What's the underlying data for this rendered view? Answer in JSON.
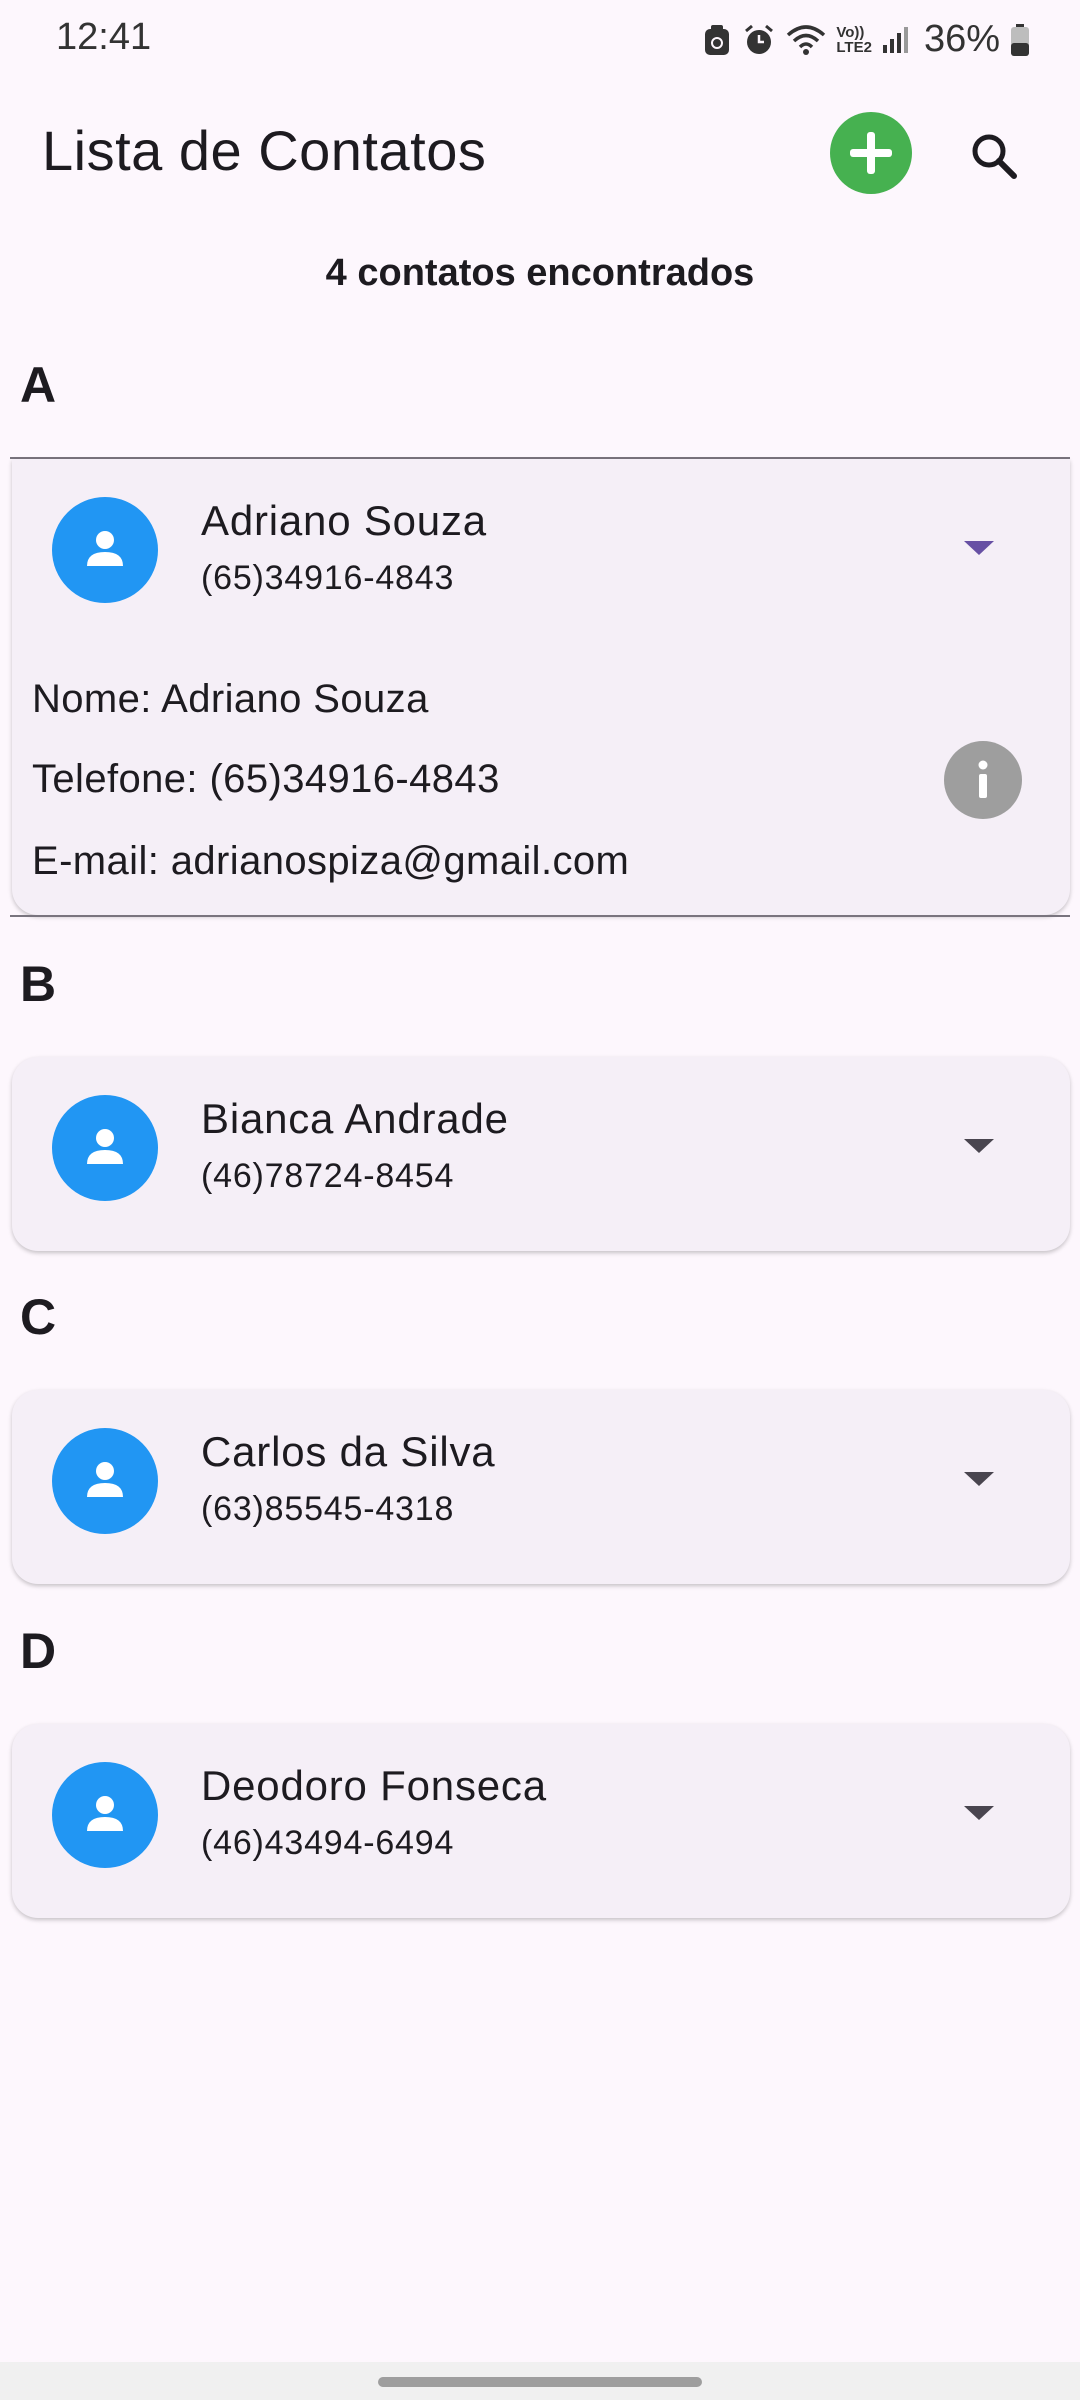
{
  "status_bar": {
    "time": "12:41",
    "battery_percent": "36%",
    "icons": [
      "cast-icon",
      "alarm-icon",
      "wifi-icon",
      "volte-icon",
      "signal-icon",
      "battery-icon"
    ],
    "volte_label_top": "Vo))",
    "volte_label_bottom": "LTE2"
  },
  "app_bar": {
    "title": "Lista de Contatos",
    "add_icon": "add-circle-icon",
    "search_icon": "search-icon"
  },
  "summary": "4 contatos encontrados",
  "colors": {
    "background": "#fdf7fd",
    "card": "#f5eff7",
    "avatar": "#2196f3",
    "add_button": "#46b150",
    "info_button": "#9e9e9e",
    "accent": "#6750a4"
  },
  "sections": [
    {
      "letter": "A",
      "contacts": [
        {
          "name": "Adriano Souza",
          "phone": "(65)34916-4843",
          "expanded": true,
          "details": {
            "name_line": "Nome: Adriano Souza",
            "phone_line": "Telefone: (65)34916-4843",
            "email_line": "E-mail: adrianospiza@gmail.com"
          }
        }
      ]
    },
    {
      "letter": "B",
      "contacts": [
        {
          "name": "Bianca Andrade",
          "phone": "(46)78724-8454",
          "expanded": false
        }
      ]
    },
    {
      "letter": "C",
      "contacts": [
        {
          "name": "Carlos da Silva",
          "phone": "(63)85545-4318",
          "expanded": false
        }
      ]
    },
    {
      "letter": "D",
      "contacts": [
        {
          "name": "Deodoro Fonseca",
          "phone": "(46)43494-6494",
          "expanded": false
        }
      ]
    }
  ]
}
